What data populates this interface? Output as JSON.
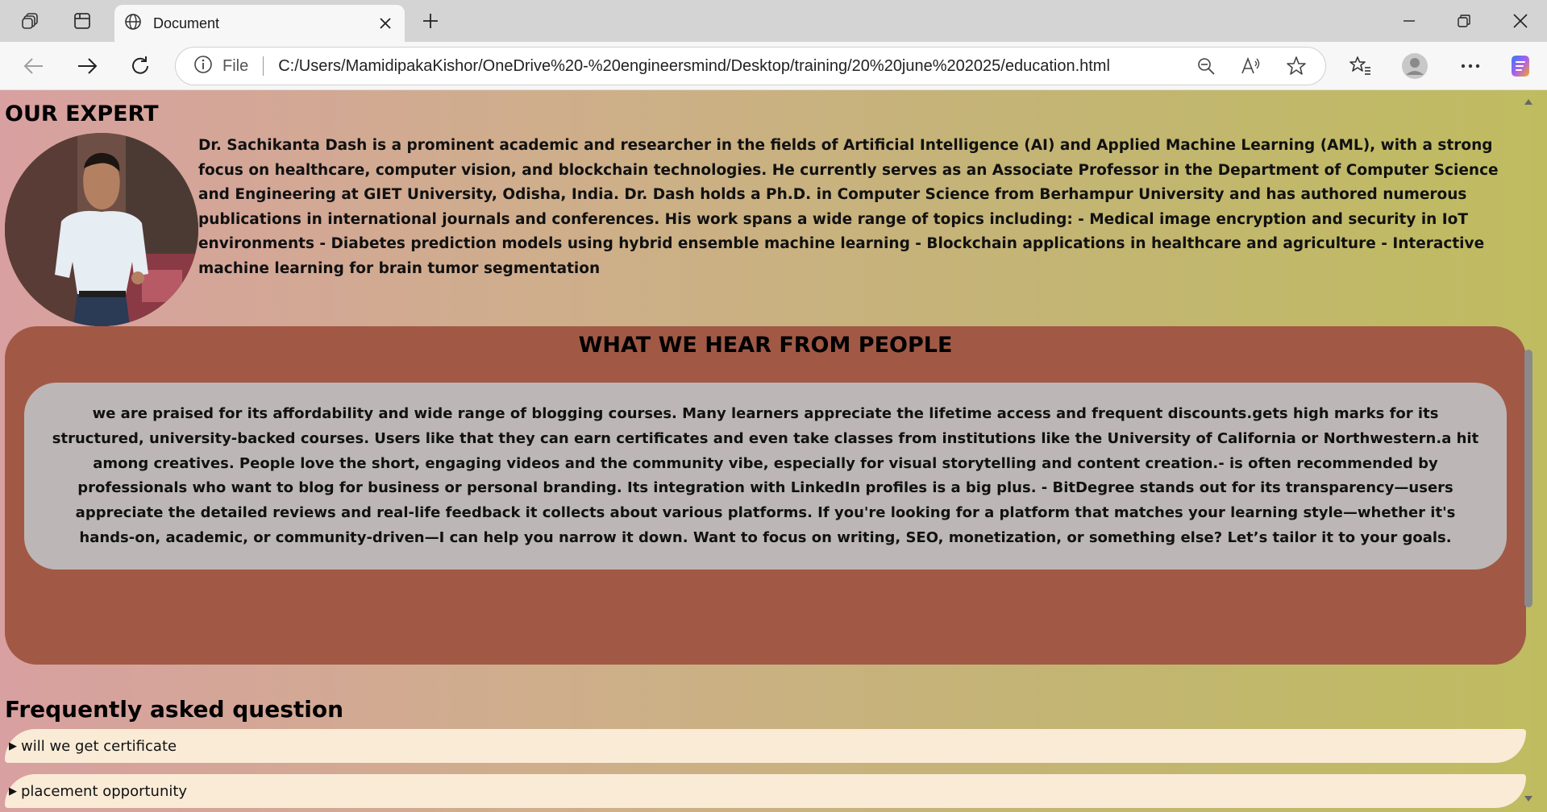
{
  "browser": {
    "tab_title": "Document",
    "address_scheme_label": "File",
    "address_url": "C:/Users/MamidipakaKishor/OneDrive%20-%20engineersmind/Desktop/training/20%20june%202025/education.html",
    "icons": [
      "workspaces-icon",
      "tab-actions-icon",
      "globe-icon",
      "close-icon",
      "plus-icon",
      "minimize-icon",
      "restore-icon",
      "window-close-icon",
      "back-icon",
      "forward-icon",
      "refresh-icon",
      "info-icon",
      "zoom-out-icon",
      "read-aloud-icon",
      "star-icon",
      "favorites-icon",
      "profile-icon",
      "more-icon",
      "copilot-icon"
    ]
  },
  "expert": {
    "heading": "OUR EXPERT",
    "bio": "Dr. Sachikanta Dash is a prominent academic and researcher in the fields of Artificial Intelligence (AI) and Applied Machine Learning (AML), with a strong focus on healthcare, computer vision, and blockchain technologies. He currently serves as an Associate Professor in the Department of Computer Science and Engineering at GIET University, Odisha, India. Dr. Dash holds a Ph.D. in Computer Science from Berhampur University and has authored numerous publications in international journals and conferences. His work spans a wide range of topics including: - Medical image encryption and security in IoT environments - Diabetes prediction models using hybrid ensemble machine learning - Blockchain applications in healthcare and agriculture - Interactive machine learning for brain tumor segmentation"
  },
  "testimonials": {
    "heading": "WHAT WE HEAR FROM PEOPLE",
    "text": "we are praised for its affordability and wide range of blogging courses. Many learners appreciate the lifetime access and frequent discounts.gets high marks for its structured, university-backed courses. Users like that they can earn certificates and even take classes from institutions like the University of California or Northwestern.a hit among creatives. People love the short, engaging videos and the community vibe, especially for visual storytelling and content creation.- is often recommended by professionals who want to blog for business or personal branding. Its integration with LinkedIn profiles is a big plus. - BitDegree stands out for its transparency—users appreciate the detailed reviews and real-life feedback it collects about various platforms. If you're looking for a platform that matches your learning style—whether it's hands-on, academic, or community-driven—I can help you narrow it down. Want to focus on writing, SEO, monetization, or something else? Let’s tailor it to your goals."
  },
  "faq": {
    "heading": "Frequently asked question",
    "items": [
      {
        "marker": "▶",
        "question": "will we get certificate"
      },
      {
        "marker": "▶",
        "question": "placement opportunity"
      }
    ]
  },
  "colors": {
    "testimonial_bg": "#a15946",
    "review_box_bg": "#bcb7b6",
    "faq_item_bg": "#faebd7"
  }
}
